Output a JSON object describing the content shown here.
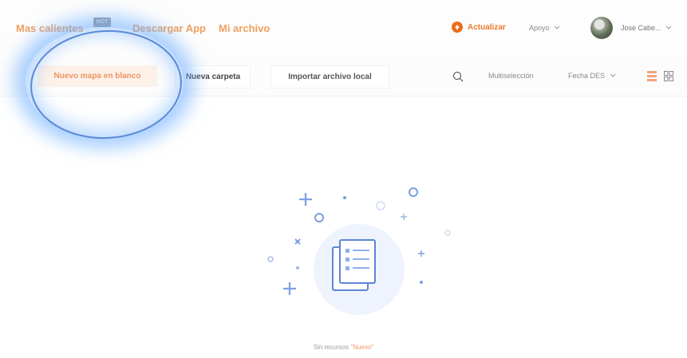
{
  "nav": {
    "hot_maps": "Mas calientes",
    "hot_badge": "HOT",
    "download_app": "Descargar App",
    "my_file": "Mi archivo"
  },
  "header": {
    "upgrade": "Actualizar",
    "support": "Apoyo",
    "username": "Jose Cabe..."
  },
  "toolbar": {
    "new_map": "Nuevo mapa en blanco",
    "new_folder": "Nueva carpeta",
    "import_local": "Importar archivo local",
    "multiselect": "Multiselección",
    "sort": "Fecha DES"
  },
  "empty_state": {
    "prefix": "Sin recursos",
    "query": "\"Nuevo\""
  },
  "colors": {
    "accent": "#ef9563",
    "upgrade": "#ea6d1e",
    "illustration": "#7b9fe0",
    "highlight": "#5a89d6"
  },
  "icons": [
    "search-icon",
    "list-view-icon",
    "grid-view-icon",
    "chevron-down-icon",
    "document-stack-icon"
  ]
}
